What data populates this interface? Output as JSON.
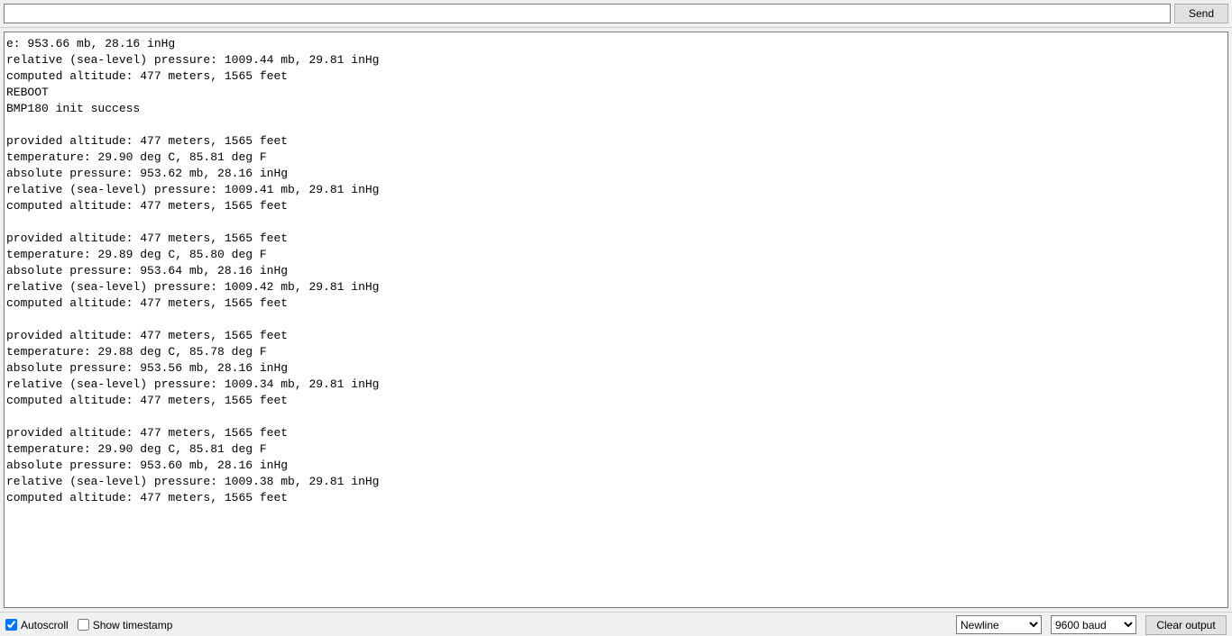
{
  "toolbar": {
    "input_value": "",
    "send_label": "Send"
  },
  "output_lines": [
    "e: 953.66 mb, 28.16 inHg",
    "relative (sea-level) pressure: 1009.44 mb, 29.81 inHg",
    "computed altitude: 477 meters, 1565 feet",
    "REBOOT",
    "BMP180 init success",
    "",
    "provided altitude: 477 meters, 1565 feet",
    "temperature: 29.90 deg C, 85.81 deg F",
    "absolute pressure: 953.62 mb, 28.16 inHg",
    "relative (sea-level) pressure: 1009.41 mb, 29.81 inHg",
    "computed altitude: 477 meters, 1565 feet",
    "",
    "provided altitude: 477 meters, 1565 feet",
    "temperature: 29.89 deg C, 85.80 deg F",
    "absolute pressure: 953.64 mb, 28.16 inHg",
    "relative (sea-level) pressure: 1009.42 mb, 29.81 inHg",
    "computed altitude: 477 meters, 1565 feet",
    "",
    "provided altitude: 477 meters, 1565 feet",
    "temperature: 29.88 deg C, 85.78 deg F",
    "absolute pressure: 953.56 mb, 28.16 inHg",
    "relative (sea-level) pressure: 1009.34 mb, 29.81 inHg",
    "computed altitude: 477 meters, 1565 feet",
    "",
    "provided altitude: 477 meters, 1565 feet",
    "temperature: 29.90 deg C, 85.81 deg F",
    "absolute pressure: 953.60 mb, 28.16 inHg",
    "relative (sea-level) pressure: 1009.38 mb, 29.81 inHg",
    "computed altitude: 477 meters, 1565 feet"
  ],
  "footer": {
    "autoscroll_label": "Autoscroll",
    "autoscroll_checked": true,
    "timestamp_label": "Show timestamp",
    "timestamp_checked": false,
    "line_ending_selected": "Newline",
    "baud_selected": "9600 baud",
    "clear_label": "Clear output"
  }
}
